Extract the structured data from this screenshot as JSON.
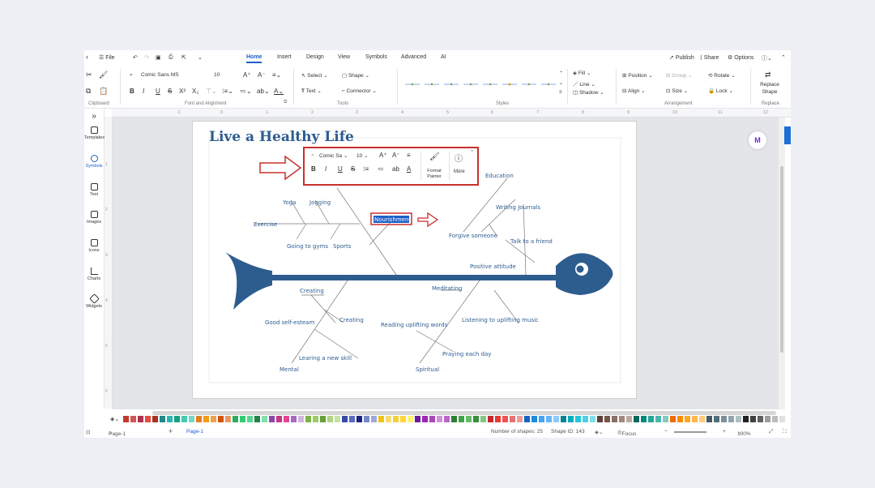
{
  "menubar": {
    "file": "File",
    "tabs": [
      {
        "label": "Home",
        "active": true
      },
      {
        "label": "Insert"
      },
      {
        "label": "Design"
      },
      {
        "label": "View"
      },
      {
        "label": "Symbols"
      },
      {
        "label": "Advanced"
      },
      {
        "label": "AI"
      }
    ],
    "publish": "Publish",
    "share": "Share",
    "options": "Options"
  },
  "ribbon": {
    "font_name": "Comic Sans MS",
    "font_size": "10",
    "select": "Select",
    "shape": "Shape",
    "text": "Text",
    "connector": "Connector",
    "fill": "Fill",
    "line": "Line",
    "shadow": "Shadow",
    "position": "Position",
    "group": "Group",
    "rotate": "Rotate",
    "align": "Align",
    "size": "Size",
    "lock": "Lock",
    "replace_shape": "Replace Shape",
    "groups": {
      "clipboard": "Clipboard",
      "font_alignment": "Font and Alignment",
      "tools": "Tools",
      "styles": "Styles",
      "arrangement": "Arrangement",
      "replace": "Replace"
    }
  },
  "ruler": [
    "-1",
    "0",
    "1",
    "2",
    "3",
    "4",
    "5",
    "6",
    "7",
    "8",
    "9",
    "10",
    "11",
    "12"
  ],
  "vruler": [
    "1",
    "2",
    "3",
    "4",
    "5",
    "6"
  ],
  "left_panel": [
    "Templates",
    "Symbols",
    "Text",
    "Images",
    "Icons",
    "Charts",
    "Widgets"
  ],
  "diagram": {
    "title": "Live a Healthy Life",
    "selected_label": "Nourishment",
    "labels": {
      "yoga": "Yoga",
      "jogging": "Jogging",
      "exercise": "Exercise",
      "going_to_gyms": "Going to gyms",
      "sports": "Sports",
      "education": "Education",
      "writing_journals": "Writing Journals",
      "forgive_someone": "Forgive someone",
      "talk_to_friend": "Talk to a friend",
      "positive_attitude": "Positive attitude",
      "creating1": "Creating",
      "good_self_esteem": "Good self-esteam",
      "creating2": "Creating",
      "learning_new_skill": "Learing a new skill",
      "mental": "Mental",
      "meditating": "Meditating",
      "reading_uplifting": "Reading uplifting words",
      "listening_music": "Listening to uplifting music",
      "praying": "Praying each day",
      "spiritual": "Spiritual"
    }
  },
  "mini_toolbar": {
    "font": "Comic Sa",
    "size": "10",
    "format_painter": "Format Painter",
    "more": "More"
  },
  "ai_badge": "M",
  "status": {
    "page_dropdown": "Page-1",
    "page_tab": "Page-1",
    "shapes": "Number of shapes: 25",
    "shape_id": "Shape ID: 143",
    "focus": "Focus",
    "zoom": "100%"
  },
  "colors": {
    "accent": "#1d5fc9",
    "fish": "#2d5d8f",
    "highlight": "#c8302d",
    "palette": [
      "#c0392b",
      "#d35454",
      "#b03050",
      "#e74c3c",
      "#a93226",
      "#1f8a8a",
      "#2bb5b5",
      "#16a085",
      "#48c9b0",
      "#76d7c4",
      "#e67e22",
      "#f39c12",
      "#f0a04b",
      "#d35400",
      "#e59866",
      "#27ae60",
      "#2ecc71",
      "#58d68d",
      "#1e8449",
      "#82e0aa",
      "#8e44ad",
      "#c0398b",
      "#e84393",
      "#a569bd",
      "#d2b4de",
      "#7cb342",
      "#9ccc65",
      "#689f38",
      "#aed581",
      "#c5e1a5",
      "#3949ab",
      "#5c6bc0",
      "#1a237e",
      "#7986cb",
      "#9fa8da",
      "#f1c40f",
      "#f7dc6f",
      "#f4d03f",
      "#fdd835",
      "#fff176",
      "#6a1b9a",
      "#9c27b0",
      "#ab47bc",
      "#ce93d8",
      "#ba68c8",
      "#2e7d32",
      "#43a047",
      "#66bb6a",
      "#388e3c",
      "#81c784",
      "#c62828",
      "#e53935",
      "#ef5350",
      "#e57373",
      "#ef9a9a",
      "#1565c0",
      "#1e88e5",
      "#42a5f5",
      "#64b5f6",
      "#90caf9",
      "#00838f",
      "#00acc1",
      "#26c6da",
      "#4dd0e1",
      "#80deea",
      "#5d4037",
      "#795548",
      "#8d6e63",
      "#a1887f",
      "#bcaaa4",
      "#00695c",
      "#00897b",
      "#26a69a",
      "#4db6ac",
      "#80cbc4",
      "#ef6c00",
      "#fb8c00",
      "#ffa726",
      "#ffb74d",
      "#ffcc80",
      "#455a64",
      "#546e7a",
      "#78909c",
      "#90a4ae",
      "#b0bec5",
      "#212121",
      "#424242",
      "#616161",
      "#9e9e9e",
      "#bdbdbd",
      "#e0e0e0"
    ]
  }
}
